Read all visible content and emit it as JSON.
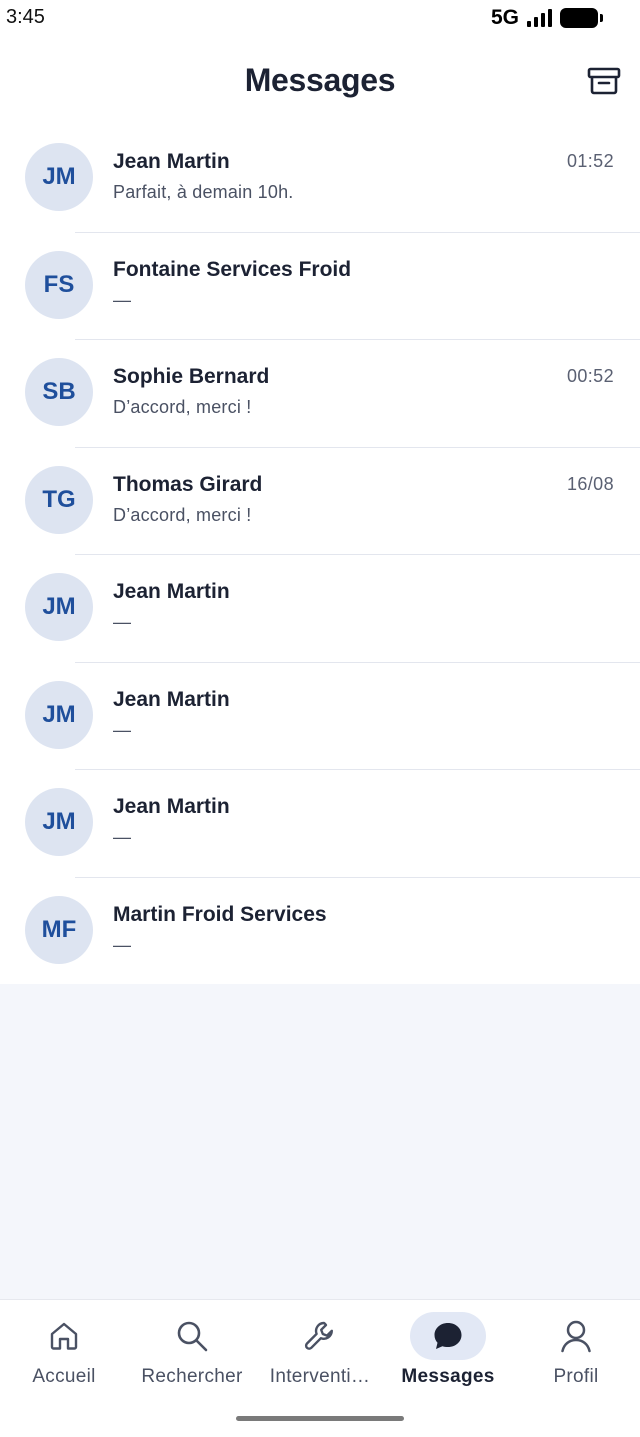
{
  "status_bar": {
    "time": "3:45",
    "network": "5G"
  },
  "header": {
    "title": "Messages",
    "archive_icon": "archive-icon"
  },
  "conversations": [
    {
      "initials": "JM",
      "name": "Jean Martin",
      "preview": "Parfait, à demain 10h.",
      "time": "01:52"
    },
    {
      "initials": "FS",
      "name": "Fontaine Services Froid",
      "preview": "—",
      "time": ""
    },
    {
      "initials": "SB",
      "name": "Sophie Bernard",
      "preview": "D’accord, merci !",
      "time": "00:52"
    },
    {
      "initials": "TG",
      "name": "Thomas Girard",
      "preview": "D’accord, merci !",
      "time": "16/08"
    },
    {
      "initials": "JM",
      "name": "Jean Martin",
      "preview": "—",
      "time": ""
    },
    {
      "initials": "JM",
      "name": "Jean Martin",
      "preview": "—",
      "time": ""
    },
    {
      "initials": "JM",
      "name": "Jean Martin",
      "preview": "—",
      "time": ""
    },
    {
      "initials": "MF",
      "name": "Martin Froid Services",
      "preview": "—",
      "time": ""
    }
  ],
  "tabbar": {
    "tabs": [
      {
        "label": "Accueil",
        "icon": "home-icon",
        "active": false
      },
      {
        "label": "Rechercher",
        "icon": "search-icon",
        "active": false
      },
      {
        "label": "Interventi…",
        "icon": "wrench-icon",
        "active": false
      },
      {
        "label": "Messages",
        "icon": "chat-bubble-icon",
        "active": true
      },
      {
        "label": "Profil",
        "icon": "user-icon",
        "active": false
      }
    ]
  },
  "colors": {
    "accent": "#1f4f9c",
    "avatar_bg": "#dde4f1",
    "active_tab_bg": "#e2e8f5",
    "page_bg": "#f4f6fb"
  }
}
